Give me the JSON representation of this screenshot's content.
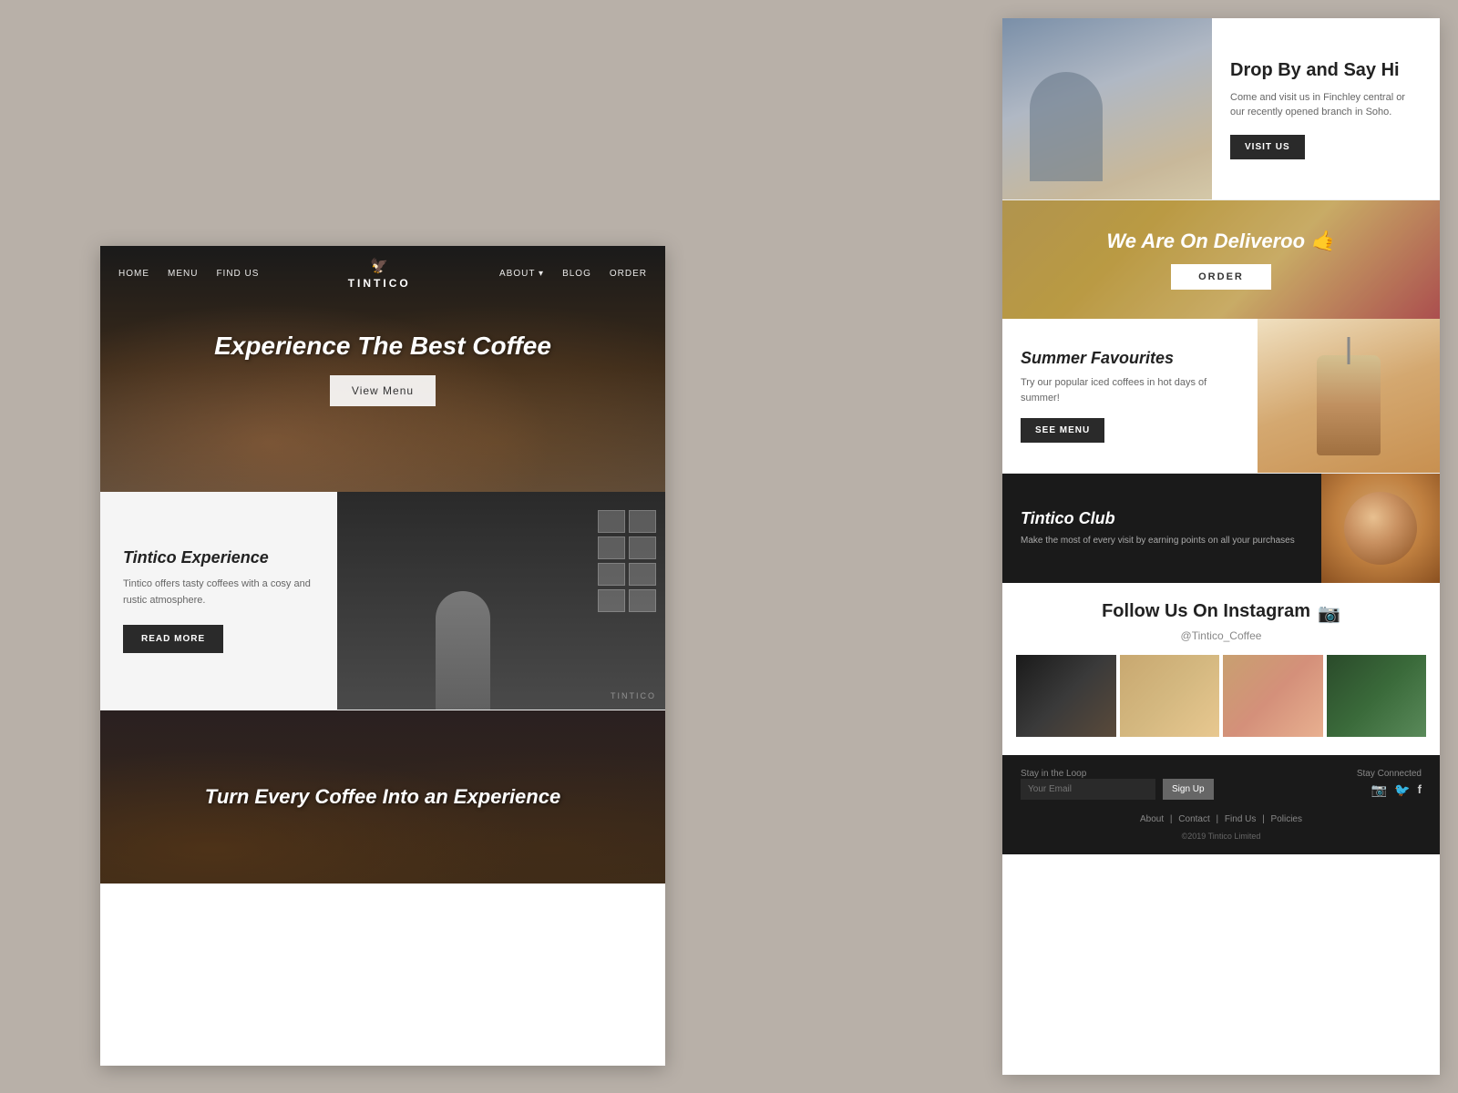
{
  "site": {
    "brand": "TINTICO",
    "tagline_hero": "Experience The Best Coffee",
    "tagline_turn": "Turn Every Coffee Into an Experience"
  },
  "nav": {
    "items_left": [
      "HOME",
      "MENU",
      "FIND US"
    ],
    "items_right": [
      "ABOUT",
      "BLOG",
      "ORDER"
    ],
    "logo_symbol": "🦅"
  },
  "hero": {
    "title": "Experience The Best Coffee",
    "view_menu_label": "View Menu"
  },
  "experience": {
    "title": "Tintico Experience",
    "description": "Tintico offers tasty coffees with a cosy and rustic atmosphere.",
    "read_more_label": "READ MORE",
    "logo_watermark": "TINTICO"
  },
  "drop_by": {
    "title": "Drop By and Say Hi",
    "description": "Come and visit us in Finchley central or our recently opened branch in Soho.",
    "button_label": "VISIT US"
  },
  "deliveroo": {
    "title": "We Are On Deliveroo 🤙",
    "button_label": "ORDER"
  },
  "summer": {
    "title": "Summer Favourites",
    "description": "Try our popular iced coffees in hot days of summer!",
    "button_label": "SEE MENU"
  },
  "club": {
    "title": "Tintico Club",
    "description": "Make the most of every visit by earning points on all your purchases"
  },
  "instagram": {
    "title": "Follow Us On Instagram",
    "handle": "@Tintico_Coffee",
    "icon": "📷"
  },
  "footer": {
    "loop_label": "Stay in the Loop",
    "email_placeholder": "Your Email",
    "signup_label": "Sign Up",
    "stay_connected_label": "Stay Connected",
    "links": [
      "About",
      "Contact",
      "Find Us",
      "Policies"
    ],
    "copyright": "©2019 Tintico Limited"
  },
  "turn_section": {
    "title": "Turn Every Coffee Into an Experience"
  }
}
